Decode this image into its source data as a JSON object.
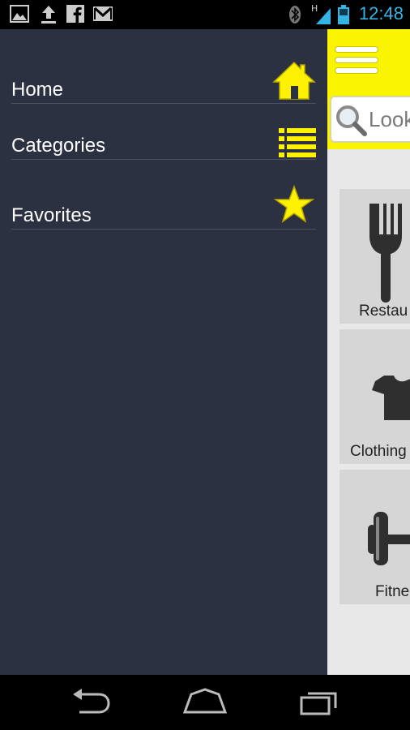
{
  "status_bar": {
    "time": "12:48",
    "notification_icons": [
      "gallery-icon",
      "upload-icon",
      "facebook-icon",
      "gmail-icon"
    ],
    "system_icons": [
      "bluetooth-icon",
      "signal-h-icon",
      "battery-icon"
    ],
    "network_label": "H"
  },
  "drawer": {
    "items": [
      {
        "label": "Home",
        "icon": "home-icon"
      },
      {
        "label": "Categories",
        "icon": "list-icon"
      },
      {
        "label": "Favorites",
        "icon": "star-icon"
      }
    ]
  },
  "main": {
    "search_placeholder": "Look",
    "categories": [
      {
        "label": "Restau",
        "icon": "fork-icon"
      },
      {
        "label": "Clothing",
        "icon": "tshirt-icon"
      },
      {
        "label": "Fitne",
        "icon": "dumbbell-icon"
      }
    ]
  },
  "colors": {
    "accent_yellow": "#fbf400",
    "drawer_bg": "#2b3140",
    "status_blue": "#33b5e5"
  },
  "nav_bar": {
    "buttons": [
      "back-icon",
      "home-nav-icon",
      "recent-apps-icon"
    ]
  }
}
